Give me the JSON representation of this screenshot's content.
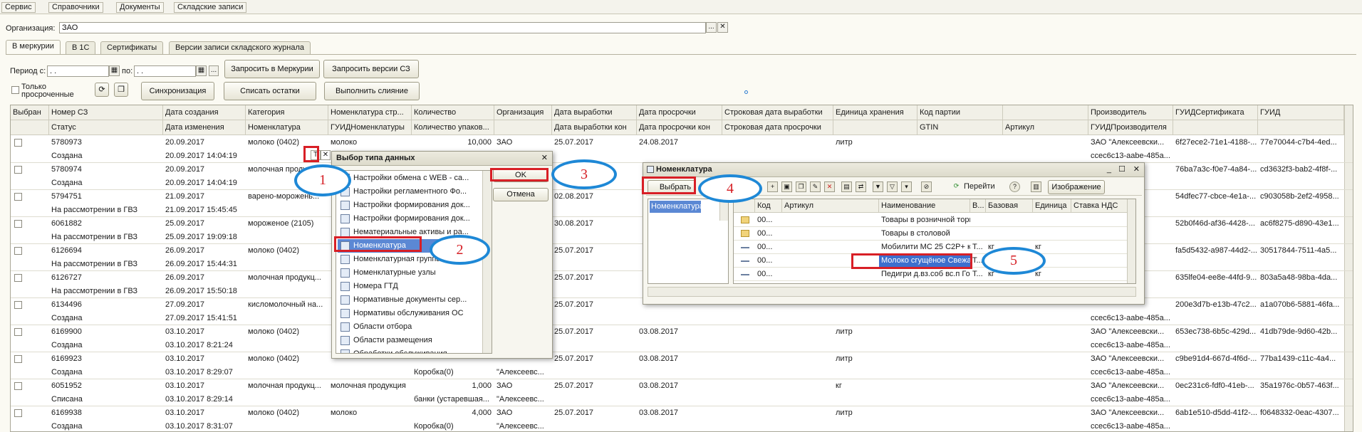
{
  "menu": [
    "Сервис",
    "Справочники",
    "Документы",
    "Складские записи"
  ],
  "org": {
    "label": "Организация:",
    "value": "ЗАО",
    "btn_more": "...",
    "btn_clear": "✕"
  },
  "tabs": [
    "В меркурии",
    "В 1С",
    "Сертификаты",
    "Версии записи складского журнала"
  ],
  "period": {
    "label_from": "Период с:",
    "from_value": " .  .",
    "label_to": "по:",
    "to_value": " .  .",
    "btn_more": "..."
  },
  "buttons": {
    "request_mercury": "Запросить в Меркурии",
    "request_versions": "Запросить версии СЗ",
    "sync": "Синхронизация",
    "write_off": "Списать остатки",
    "merge": "Выполнить слияние"
  },
  "only_expired": "Только\nпросроченные",
  "grid": {
    "headers1": [
      "Выбран",
      "Номер СЗ",
      "Дата создания",
      "Категория",
      "Номенклатура стр...",
      "Количество",
      "Организация",
      "Дата выработки",
      "Дата просрочки",
      "Строковая дата выработки",
      "Единица хранения",
      "Код партии",
      "",
      "Производитель",
      "ГУИДСертификата",
      "ГУИД"
    ],
    "headers2": [
      "",
      "Статус",
      "Дата изменения",
      "Номенклатура",
      "ГУИДНоменклатуры",
      "Количество упаков...",
      "",
      "Дата выработки кон",
      "Дата просрочки кон",
      "Строковая дата просрочки",
      "",
      "GTIN",
      "Артикул",
      "ГУИДПроизводителя",
      "",
      ""
    ],
    "rows": [
      {
        "num": "5780973",
        "status": "Создана",
        "created": "20.09.2017",
        "changed": "20.09.2017 14:04:19",
        "category": "молоко (0402)",
        "nom": "",
        "nomstr": "молоко",
        "qty": "10,000",
        "qtypack": "",
        "org": "ЗАО",
        "org2": "",
        "prod": "25.07.2017",
        "prod2": "",
        "exp": "24.08.2017",
        "unit": "литр",
        "maker": "ЗАО \"Алексеевски...",
        "maker2": "ccec6c13-aabe-485a...",
        "cert": "6f27ece2-71e1-4188-...",
        "guid": "77e70044-c7b4-4ed..."
      },
      {
        "num": "5780974",
        "status": "Создана",
        "created": "20.09.2017",
        "changed": "20.09.2017 14:04:19",
        "category": "молочная продук...",
        "nom": "",
        "nomstr": "",
        "qty": "",
        "qtypack": "",
        "org": "",
        "org2": "",
        "prod": "",
        "prod2": "",
        "exp": "",
        "unit": "",
        "maker": "",
        "maker2": "",
        "cert": "76ba7a3c-f0e7-4a84-...",
        "guid": "cd3632f3-bab2-4f8f-..."
      },
      {
        "num": "5794751",
        "status": "На рассмотрении в ГВЗ",
        "created": "21.09.2017",
        "changed": "21.09.2017 15:45:45",
        "category": "варено-морожень...",
        "nom": "",
        "nomstr": "",
        "qty": "",
        "qtypack": "",
        "org": "",
        "org2": "",
        "prod": "02.08.2017",
        "prod2": "",
        "exp": "",
        "unit": "",
        "maker": "",
        "maker2": "",
        "cert": "54dfec77-cbce-4e1a-...",
        "guid": "c903058b-2ef2-4958..."
      },
      {
        "num": "6061882",
        "status": "На рассмотрении в ГВЗ",
        "created": "25.09.2017",
        "changed": "25.09.2017 19:09:18",
        "category": "мороженое (2105)",
        "nom": "",
        "nomstr": "",
        "qty": "",
        "qtypack": "",
        "org": "",
        "org2": "",
        "prod": "30.08.2017",
        "prod2": "",
        "exp": "",
        "unit": "",
        "maker": "",
        "maker2": "",
        "cert": "52b0f46d-af36-4428-...",
        "guid": "ac6f8275-d890-43e1..."
      },
      {
        "num": "6126694",
        "status": "На рассмотрении в ГВЗ",
        "created": "26.09.2017",
        "changed": "26.09.2017 15:44:31",
        "category": "молоко (0402)",
        "nom": "",
        "nomstr": "",
        "qty": "",
        "qtypack": "",
        "org": "",
        "org2": "",
        "prod": "25.07.2017",
        "prod2": "",
        "exp": "",
        "unit": "",
        "maker": "",
        "maker2": "",
        "cert": "fa5d5432-a987-44d2-...",
        "guid": "30517844-7511-4a5..."
      },
      {
        "num": "6126727",
        "status": "На рассмотрении в ГВЗ",
        "created": "26.09.2017",
        "changed": "26.09.2017 15:50:18",
        "category": "молочная продукц...",
        "nom": "",
        "nomstr": "",
        "qty": "",
        "qtypack": "",
        "org": "",
        "org2": "",
        "prod": "25.07.2017",
        "prod2": "",
        "exp": "",
        "unit": "",
        "maker": "",
        "maker2": "",
        "cert": "635lfe04-ee8e-44fd-9...",
        "guid": "803a5a48-98ba-4da..."
      },
      {
        "num": "6134496",
        "status": "Создана",
        "created": "27.09.2017",
        "changed": "27.09.2017 15:41:51",
        "category": "кисломолочный на...",
        "nom": "",
        "nomstr": "",
        "qty": "",
        "qtypack": "",
        "org": "",
        "org2": "",
        "prod": "25.07.2017",
        "prod2": "",
        "exp": "",
        "unit": "",
        "maker": "",
        "maker2": "ccec6c13-aabe-485a...",
        "cert": "200e3d7b-e13b-47c2...",
        "guid": "a1a070b6-5881-46fa..."
      },
      {
        "num": "6169900",
        "status": "Создана",
        "created": "03.10.2017",
        "changed": "03.10.2017 8:21:24",
        "category": "молоко (0402)",
        "nom": "",
        "nomstr": "",
        "qty": "",
        "qtypack": "",
        "org": "",
        "org2": "",
        "prod": "25.07.2017",
        "prod2": "",
        "exp": "03.08.2017",
        "unit": "литр",
        "maker": "ЗАО \"Алексеевски...",
        "maker2": "ccec6c13-aabe-485a...",
        "cert": "653ec738-6b5c-429d...",
        "guid": "41db79de-9d60-42b..."
      },
      {
        "num": "6169923",
        "status": "Создана",
        "created": "03.10.2017",
        "changed": "03.10.2017 8:29:07",
        "category": "молоко (0402)",
        "nom": "",
        "nomstr": "",
        "qty": "",
        "qtypack": "Коробка(0)",
        "org": "",
        "org2": "\"Алексеевс...",
        "prod": "25.07.2017",
        "prod2": "",
        "exp": "03.08.2017",
        "unit": "литр",
        "maker": "ЗАО \"Алексеевски...",
        "maker2": "ccec6c13-aabe-485a...",
        "cert": "c9be91d4-667d-4f6d-...",
        "guid": "77ba1439-c11c-4a4..."
      },
      {
        "num": "6051952",
        "status": "Списана",
        "created": "03.10.2017",
        "changed": "03.10.2017 8:29:14",
        "category": "молочная продукц...",
        "nom": "",
        "nomstr": "молочная продукция",
        "qty": "1,000",
        "qtypack": "банки (устаревшая...",
        "org": "ЗАО",
        "org2": "\"Алексеевс...",
        "prod": "25.07.2017",
        "prod2": "",
        "exp": "03.08.2017",
        "unit": "кг",
        "maker": "ЗАО \"Алексеевски...",
        "maker2": "ccec6c13-aabe-485a...",
        "cert": "0ec231c6-fdf0-41eb-...",
        "guid": "35a1976c-0b57-463f..."
      },
      {
        "num": "6169938",
        "status": "Создана",
        "created": "03.10.2017",
        "changed": "03.10.2017 8:31:07",
        "category": "молоко (0402)",
        "nom": "",
        "nomstr": "молоко",
        "qty": "4,000",
        "qtypack": "Коробка(0)",
        "org": "ЗАО",
        "org2": "\"Алексеевс...",
        "prod": "25.07.2017",
        "prod2": "",
        "exp": "03.08.2017",
        "unit": "литр",
        "maker": "ЗАО \"Алексеевски...",
        "maker2": "ccec6c13-aabe-485a...",
        "cert": "6ab1e510-d5dd-41f2-...",
        "guid": "f0648332-0eac-4307..."
      }
    ]
  },
  "dialog_type": {
    "title": "Выбор типа данных",
    "close": "✕",
    "ok": "OK",
    "cancel": "Отмена",
    "items": [
      "Настройки обмена с WEB - са...",
      "Настройки регламентного Фо...",
      "Настройки формирования док...",
      "Настройки формирования док...",
      "Нематериальные активы и ра...",
      "Номенклатура",
      "Номенклатурная группа",
      "Номенклатурные узлы",
      "Номера ГТД",
      "Нормативные документы сер...",
      "Нормативы обслуживания ОС",
      "Области отбора",
      "Области размещения",
      "Обработки обслуживания..."
    ]
  },
  "dialog_nom": {
    "title": "Номенклатура",
    "select": "Выбрать",
    "goto": "Перейти",
    "image": "Изображение",
    "tree_item": "Номенклатура",
    "headers": [
      "Код",
      "Артикул",
      "Наименование",
      "В...",
      "Базовая",
      "Единица",
      "Ставка НДС"
    ],
    "rows": [
      {
        "code": "00...",
        "name": "Товары в розничной торговле",
        "b": "",
        "base": "",
        "unit": ""
      },
      {
        "code": "00...",
        "name": "Товары в столовой",
        "b": "",
        "base": "",
        "unit": ""
      },
      {
        "code": "00...",
        "name": "Мобилити МС 25 С2Р+ канин...",
        "b": "Т...",
        "base": "кг",
        "unit": "кг"
      },
      {
        "code": "00...",
        "name": "Молоко сгущёное Свежая М...",
        "b": "Т...",
        "base": "кг",
        "unit": "кг"
      },
      {
        "code": "00...",
        "name": "Педигри д.вз.соб вс.п Говяд...",
        "b": "Т...",
        "base": "кг",
        "unit": "кг"
      }
    ],
    "btn_min": "_",
    "btn_max": "☐",
    "btn_close": "✕"
  },
  "inline_edit": {
    "t_btn": "T",
    "x_btn": "✕"
  },
  "callouts": [
    "1",
    "2",
    "3",
    "4",
    "5"
  ]
}
